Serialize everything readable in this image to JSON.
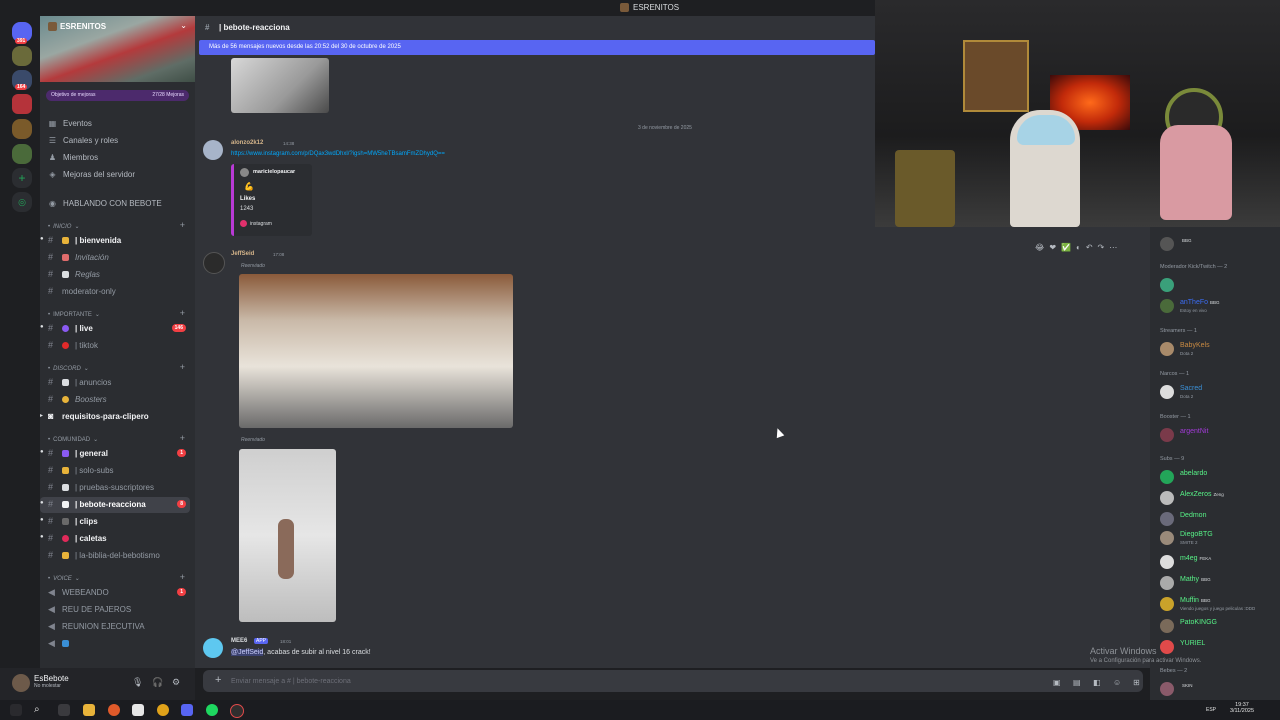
{
  "window": {
    "title": "ESRENITOS"
  },
  "server": {
    "name": "ESRENITOS",
    "boost_label": "Objetivo de mejoras",
    "boost_value": "27/28 Mejoras"
  },
  "rail_badges": [
    "391",
    "164"
  ],
  "nav": [
    {
      "label": "Eventos",
      "icon": "calendar-icon"
    },
    {
      "label": "Canales y roles",
      "icon": "channels-icon"
    },
    {
      "label": "Miembros",
      "icon": "members-icon"
    },
    {
      "label": "Mejoras del servidor",
      "icon": "boost-icon"
    },
    {
      "label": "HABLANDO CON BEBOTE",
      "icon": "voice-icon"
    }
  ],
  "categories": {
    "inicio": "INICIO",
    "importante": "IMPORTANTE",
    "discord": "DISCORD",
    "comunidad": "COMUNIDAD",
    "voice": "VOICE"
  },
  "channels": [
    {
      "name": "| bienvenida"
    },
    {
      "name": "Invitación"
    },
    {
      "name": "Reglas"
    },
    {
      "name": "moderator-only"
    },
    {
      "name": "| live",
      "count": "146"
    },
    {
      "name": "| tiktok"
    },
    {
      "name": "| anuncios"
    },
    {
      "name": "Boosters"
    },
    {
      "name": "requisitos-para-clipero"
    },
    {
      "name": "| general",
      "count": "1"
    },
    {
      "name": "| solo-subs"
    },
    {
      "name": "| pruebas-suscriptores"
    },
    {
      "name": "| bebote-reacciona",
      "count": "8"
    },
    {
      "name": "| clips"
    },
    {
      "name": "| caletas"
    },
    {
      "name": "| la-biblia-del-bebotismo"
    },
    {
      "name": "WEBEANDO",
      "count": "1"
    },
    {
      "name": "REU DE PAJEROS"
    },
    {
      "name": "REUNION EJECUTIVA"
    },
    {
      "name": ""
    }
  ],
  "user": {
    "name": "EsBebote",
    "status": "No molestar"
  },
  "chat": {
    "channel": "| bebote-reacciona",
    "new_messages": "Más de 56 mensajes nuevos desde las 20:52 del 30 de octubre de 2025",
    "date_separator": "3 de noviembre de 2025",
    "messages": [
      {
        "author": "alonzo2k12",
        "time": "14:38",
        "link": "https://www.instagram.com/p/DQax3wdDhxl/?igsh=MW5heTBsamFmZDhydQ==",
        "embed": {
          "account": "maricielopaucar",
          "title": "Likes",
          "value": "1243",
          "provider": "instagram"
        }
      },
      {
        "author": "JeffSeid",
        "time": "17:08",
        "forwarded": "Reenviado",
        "forwarded2": "Reenviado"
      },
      {
        "author": "MEE6",
        "app": "APP",
        "time": "18:01",
        "mention": "@JeffSeid",
        "text": ", acabas de subir al nivel 16 crack!"
      }
    ],
    "composer_placeholder": "Enviar mensaje a #",
    "composer_channel": "bebote-reacciona"
  },
  "members": {
    "groups": [
      {
        "label": "Moderador Kick/Twitch — 2"
      },
      {
        "label": "Streamers — 1"
      },
      {
        "label": "Narcos — 1"
      },
      {
        "label": "Booster — 1"
      },
      {
        "label": "Subs — 9"
      },
      {
        "label": "Bebes — 2"
      }
    ],
    "list": [
      {
        "name": "",
        "tag": "BBG",
        "color": "#dbdee1"
      },
      {
        "name": "",
        "color": "#e06c3c"
      },
      {
        "name": "anTheFo",
        "tag": "BBG",
        "sub": "Estoy en vivo",
        "color": "#3b6cf2"
      },
      {
        "name": "BabyKels",
        "sub": "Dota 2",
        "color": "#c98a42"
      },
      {
        "name": "Sacred",
        "sub": "Dota 2",
        "color": "#3a8fd6"
      },
      {
        "name": "argentNit",
        "color": "#a13ad6"
      },
      {
        "name": "abelardo",
        "color": "#57f287"
      },
      {
        "name": "AlexZeros",
        "tag": "Zeng",
        "color": "#57f287"
      },
      {
        "name": "Dedmon",
        "color": "#57f287"
      },
      {
        "name": "DiegoBTG",
        "sub": "SMITE 2",
        "color": "#57f287"
      },
      {
        "name": "m4eg",
        "tag": "FEKA",
        "color": "#57f287"
      },
      {
        "name": "Mathy",
        "tag": "BBG",
        "color": "#57f287"
      },
      {
        "name": "Muffin",
        "tag": "BBG",
        "sub": "Viendo juegos y juego peliculas :DDD",
        "color": "#57f287"
      },
      {
        "name": "PatoKINGG",
        "color": "#57f287"
      },
      {
        "name": "YURIEL",
        "color": "#57f287"
      },
      {
        "name": "",
        "tag": "SKIN",
        "color": "#e06ad6"
      }
    ]
  },
  "watermark": {
    "line1": "Activar Windows",
    "line2": "Ve a Configuración para activar Windows."
  },
  "taskbar": {
    "lang": "ESP",
    "time": "19:37",
    "date": "3/11/2025"
  }
}
